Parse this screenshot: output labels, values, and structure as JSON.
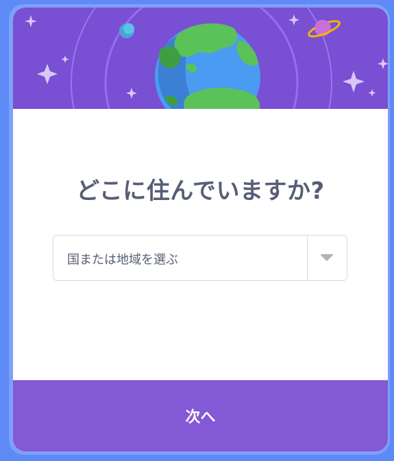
{
  "dialog": {
    "title": "どこに住んでいますか?",
    "country_select": {
      "placeholder": "国または地域を選ぶ"
    },
    "next_label": "次へ"
  },
  "colors": {
    "background": "#5d8af6",
    "banner": "#794fd3",
    "footer": "#8359d6",
    "title_text": "#575e75"
  },
  "icons": [
    "earth-icon",
    "planet-icon",
    "moon-icon",
    "sparkle-icon",
    "chevron-down-icon"
  ]
}
